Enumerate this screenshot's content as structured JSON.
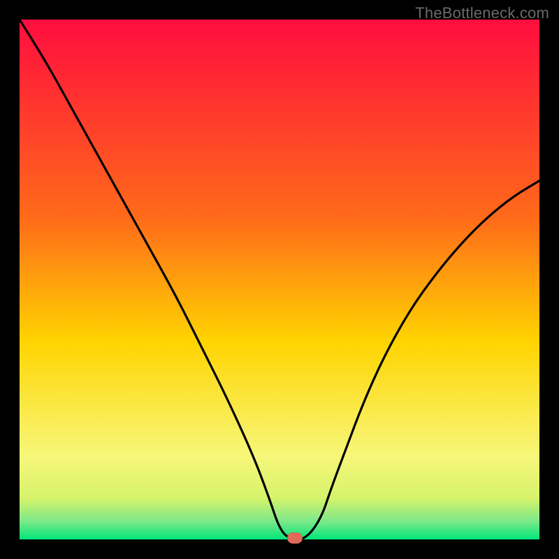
{
  "watermark": "TheBottleneck.com",
  "colors": {
    "frame": "#000000",
    "curve": "#000000",
    "marker": "#e26a5a",
    "gradient_top": "#ff0d3e",
    "gradient_mid": "#ff8c1a",
    "gradient_yellow": "#fff200",
    "gradient_green": "#00e579",
    "baseline_band": "#00e579"
  },
  "axes": {
    "xlabel": "",
    "ylabel": "",
    "x_range": [
      0,
      100
    ],
    "y_range": [
      0,
      100
    ],
    "ticks_shown": false,
    "grid": false
  },
  "chart_data": {
    "type": "line",
    "title": "",
    "xlabel": "",
    "ylabel": "",
    "x_range": [
      0,
      100
    ],
    "y_range": [
      0,
      100
    ],
    "series": [
      {
        "name": "bottleneck-curve",
        "color": "#000000",
        "x": [
          0,
          5,
          10,
          15,
          20,
          25,
          30,
          35,
          40,
          45,
          48,
          50,
          52,
          55,
          58,
          60,
          63,
          66,
          70,
          75,
          80,
          85,
          90,
          95,
          100
        ],
        "y": [
          100,
          92,
          83,
          74,
          65,
          56,
          47,
          37,
          27,
          16,
          8,
          2,
          0,
          0,
          4,
          10,
          18,
          26,
          35,
          44,
          51,
          57,
          62,
          66,
          69
        ]
      }
    ],
    "marker": {
      "x": 53,
      "y": 0,
      "color": "#e26a5a",
      "shape": "rounded-rect"
    },
    "background_gradient": {
      "direction": "vertical",
      "stops": [
        {
          "pos": 0.0,
          "color": "#ff0d3e"
        },
        {
          "pos": 0.38,
          "color": "#ff6a1a"
        },
        {
          "pos": 0.62,
          "color": "#ffd400"
        },
        {
          "pos": 0.84,
          "color": "#f7f77a"
        },
        {
          "pos": 0.92,
          "color": "#d6f36a"
        },
        {
          "pos": 0.965,
          "color": "#7de88a"
        },
        {
          "pos": 1.0,
          "color": "#00e579"
        }
      ]
    }
  }
}
